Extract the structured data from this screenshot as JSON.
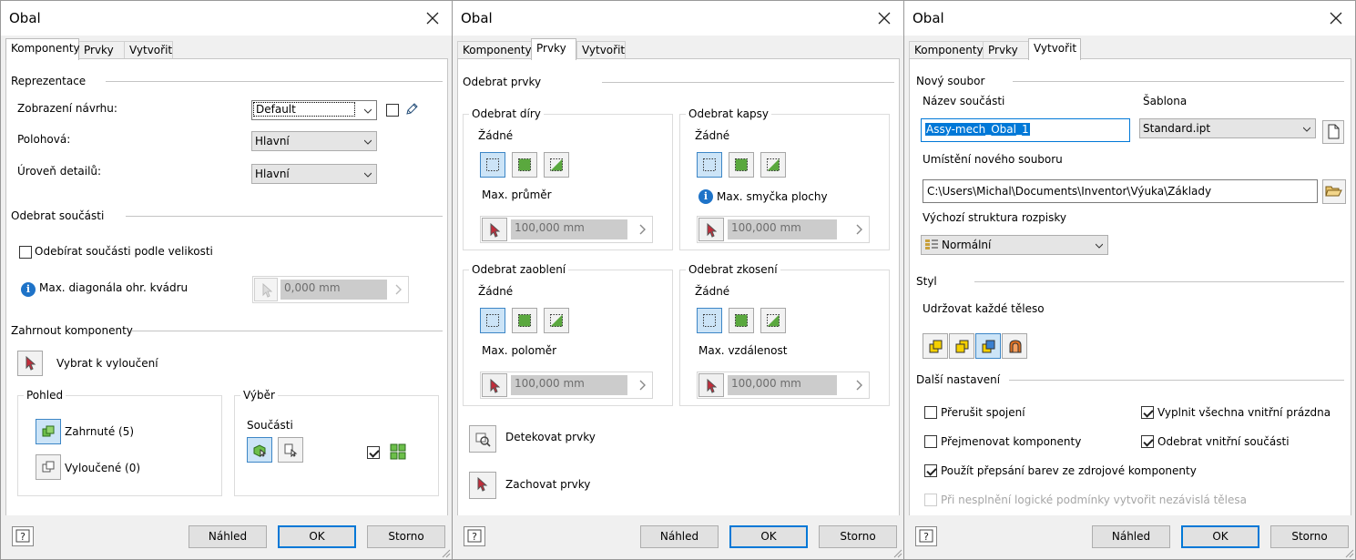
{
  "dialog_title": "Obal",
  "tabs": [
    "Komponenty",
    "Prvky",
    "Vytvořit"
  ],
  "footer": {
    "preview": "Náhled",
    "ok": "OK",
    "cancel": "Storno"
  },
  "komponenty": {
    "representation": {
      "section": "Reprezentace",
      "design_view_label": "Zobrazení návrhu:",
      "design_view_value": "Default",
      "positional_label": "Polohová:",
      "positional_value": "Hlavní",
      "detail_label": "Úroveň detailů:",
      "detail_value": "Hlavní"
    },
    "remove_parts": {
      "section": "Odebrat součásti",
      "by_size_label": "Odebírat součásti podle velikosti",
      "max_diag_label": "Max. diagonála ohr. kvádru",
      "max_diag_value": "0,000 mm"
    },
    "include": {
      "section": "Zahrnout komponenty",
      "select_exclude_label": "Vybrat k vyloučení",
      "view_group": "Pohled",
      "included_label": "Zahrnuté (5)",
      "excluded_label": "Vyloučené (0)",
      "selection_group": "Výběr",
      "parts_label": "Součásti"
    }
  },
  "prvky": {
    "section": "Odebrat prvky",
    "holes": {
      "title": "Odebrat díry",
      "mode": "Žádné",
      "param_label": "Max. průměr",
      "value": "100,000 mm"
    },
    "pockets": {
      "title": "Odebrat kapsy",
      "mode": "Žádné",
      "param_label": "Max. smyčka plochy",
      "value": "100,000 mm"
    },
    "fillets": {
      "title": "Odebrat zaoblení",
      "mode": "Žádné",
      "param_label": "Max. poloměr",
      "value": "100,000 mm"
    },
    "chamfers": {
      "title": "Odebrat zkosení",
      "mode": "Žádné",
      "param_label": "Max. vzdálenost",
      "value": "100,000 mm"
    },
    "detect_label": "Detekovat prvky",
    "keep_label": "Zachovat prvky"
  },
  "vytvorit": {
    "new_file_section": "Nový soubor",
    "part_name_label": "Název součásti",
    "part_name_value": "Assy-mech_Obal_1",
    "template_label": "Šablona",
    "template_value": "Standard.ipt",
    "location_label": "Umístění nového souboru",
    "location_value": "C:\\Users\\Michal\\Documents\\Inventor\\Výuka\\Základy",
    "bom_label": "Výchozí struktura rozpisky",
    "bom_value": "Normální",
    "style_section": "Styl",
    "style_label": "Udržovat každé těleso",
    "other_section": "Další nastavení",
    "break_link": "Přerušit spojení",
    "fill_voids": "Vyplnit všechna vnitřní prázdna",
    "rename_components": "Přejmenovat komponenty",
    "remove_internal": "Odebrat vnitřní součásti",
    "color_override": "Použít přepsání barev ze zdrojové komponenty",
    "independent_bodies": "Při nesplnění logické podmínky vytvořit nezávislá tělesa"
  }
}
